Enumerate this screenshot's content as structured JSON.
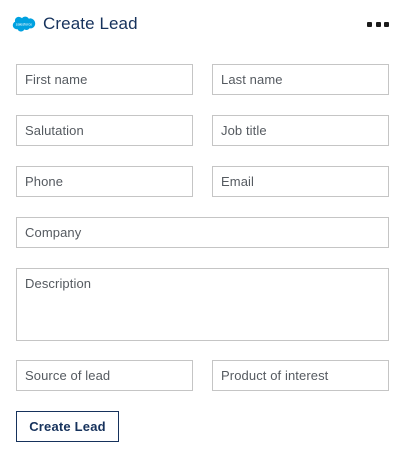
{
  "header": {
    "logo_text": "salesforce",
    "title": "Create Lead",
    "more_icon": "ellipsis-icon"
  },
  "form": {
    "first_name_placeholder": "First name",
    "last_name_placeholder": "Last name",
    "salutation_placeholder": "Salutation",
    "job_title_placeholder": "Job title",
    "phone_placeholder": "Phone",
    "email_placeholder": "Email",
    "company_placeholder": "Company",
    "description_placeholder": "Description",
    "source_placeholder": "Source of lead",
    "product_placeholder": "Product of interest",
    "submit_label": "Create Lead"
  },
  "colors": {
    "brand_cloud": "#00a1e0",
    "title_text": "#16325c",
    "field_border": "#c5c5c5"
  }
}
